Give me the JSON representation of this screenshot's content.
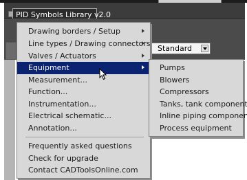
{
  "menubar": {
    "title": "PID Symbols Library v2.0"
  },
  "background": {
    "dropdown_value": "Standard"
  },
  "menu": {
    "items": [
      {
        "label": "Drawing borders / Setup",
        "has_submenu": true
      },
      {
        "label": "Line types / Drawing connectors",
        "has_submenu": true
      },
      {
        "label": "Valves / Actuators",
        "has_submenu": true
      },
      {
        "label": "Equipment",
        "has_submenu": true,
        "selected": true
      },
      {
        "label": "Measurement..."
      },
      {
        "label": "Function..."
      },
      {
        "label": "Instrumentation..."
      },
      {
        "label": "Electrical schematic..."
      },
      {
        "label": "Annotation..."
      },
      {
        "label": "Frequently asked questions"
      },
      {
        "label": "Check for upgrade"
      },
      {
        "label": "Contact CADToolsOnline.com"
      }
    ]
  },
  "submenu": {
    "items": [
      {
        "label": "Pumps"
      },
      {
        "label": "Blowers"
      },
      {
        "label": "Compressors"
      },
      {
        "label": "Tanks, tank components"
      },
      {
        "label": "Inline piping components"
      },
      {
        "label": "Process equipment"
      }
    ]
  },
  "colors": {
    "selection": "#0b2370",
    "menu_bg": "#d8d8d8"
  },
  "icons": {
    "cursor": "mouse-pointer-icon",
    "submenu_arrow": "chevron-right-icon"
  }
}
